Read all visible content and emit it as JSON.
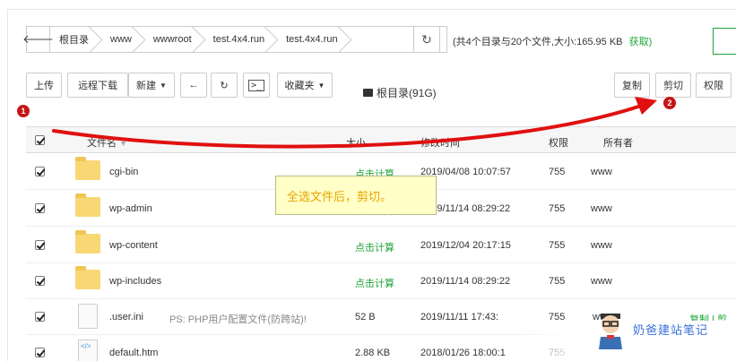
{
  "pathbar": {
    "crumbs": [
      "根目录",
      "www",
      "wwwroot",
      "test.4x4.run",
      "test.4x4.run"
    ],
    "summary": "(共4个目录与20个文件,大小:165.95 KB",
    "get_link": "获取)"
  },
  "toolbar": {
    "upload": "上传",
    "remote_download": "远程下载",
    "new": "新建",
    "favorites": "收藏夹",
    "disk": "根目录(91G)",
    "copy": "复制",
    "cut": "剪切",
    "permission": "权限"
  },
  "table": {
    "headers": {
      "name": "文件名",
      "size": "大小",
      "mtime": "修改时间",
      "perm": "权限",
      "owner": "所有者"
    },
    "rows": [
      {
        "name": "cgi-bin",
        "type": "folder",
        "size": "点击计算",
        "mtime": "2019/04/08 10:07:57",
        "perm": "755",
        "owner": "www",
        "note": ""
      },
      {
        "name": "wp-admin",
        "type": "folder",
        "size": "点击计算",
        "mtime": "2019/11/14 08:29:22",
        "perm": "755",
        "owner": "www",
        "note": ""
      },
      {
        "name": "wp-content",
        "type": "folder",
        "size": "点击计算",
        "mtime": "2019/12/04 20:17:15",
        "perm": "755",
        "owner": "www",
        "note": ""
      },
      {
        "name": "wp-includes",
        "type": "folder",
        "size": "点击计算",
        "mtime": "2019/11/14 08:29:22",
        "perm": "755",
        "owner": "www",
        "note": ""
      },
      {
        "name": ".user.ini",
        "type": "file",
        "size": "52 B",
        "mtime": "2019/11/11 17:43:",
        "perm": "755",
        "owner": "ww",
        "note": "PS: PHP用户配置文件(防跨站)!"
      },
      {
        "name": "default.htm",
        "type": "code",
        "size": "2.88 KB",
        "mtime": "2018/01/26 18:00:1",
        "perm": "755",
        "owner": "",
        "note": ""
      }
    ],
    "row_actions": "复制 | 剪"
  },
  "annotations": {
    "callout": "全选文件后，剪切。",
    "badge1": "1",
    "badge2": "2"
  },
  "watermark": "奶爸建站笔记",
  "colors": {
    "accent": "#20a53a",
    "arrow": "#e01010",
    "callout_bg": "#ffffc7"
  }
}
